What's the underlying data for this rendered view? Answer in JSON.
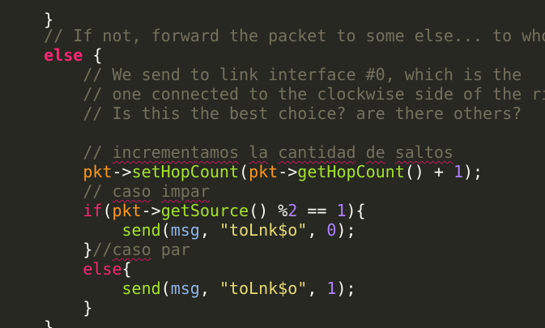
{
  "editor": {
    "theme": {
      "background": "#272822",
      "comment": "#75715e",
      "keyword": "#f92672",
      "function": "#a6e22e",
      "variable": "#fd971f",
      "number": "#ae81ff",
      "string": "#e6db74",
      "plain": "#f8f8f2",
      "spellcheck_underline": "#c2185b"
    },
    "lines": {
      "l0": {
        "t0": "}"
      },
      "l1": {
        "t0": "// If not, forward the packet to some else... to who?"
      },
      "l2": {
        "t0": "else",
        "t1": " {"
      },
      "l3": {
        "t0": "    // We send to link interface #0, which is the"
      },
      "l4": {
        "t0": "    // one connected to the clockwise side of the ring"
      },
      "l5": {
        "t0": "    // Is this the best choice? are there others?"
      },
      "l6": {
        "t0": ""
      },
      "l7": {
        "t0": "    ",
        "t1": "// ",
        "t2": "incrementamos",
        "t3": " ",
        "t4": "la",
        "t5": " ",
        "t6": "cantidad",
        "t7": " ",
        "t8": "de",
        "t9": " ",
        "t10": "saltos"
      },
      "l8": {
        "t0": "    ",
        "t1": "pkt",
        "t2": "->",
        "t3": "setHopCount",
        "t4": "(",
        "t5": "pkt",
        "t6": "->",
        "t7": "getHopCount",
        "t8": "() + ",
        "t9": "1",
        "t10": ");"
      },
      "l9": {
        "t0": "    ",
        "t1": "// ",
        "t2": "caso",
        "t3": " ",
        "t4": "impar"
      },
      "l10": {
        "t0": "    ",
        "t1": "if",
        "t2": "(",
        "t3": "pkt",
        "t4": "->",
        "t5": "getSource",
        "t6": "() ",
        "t7": "%",
        "t8": "2",
        "t9": " == ",
        "t10": "1",
        "t11": "){"
      },
      "l11": {
        "t0": "        ",
        "t1": "send",
        "t2": "(",
        "t3": "msg",
        "t4": ", ",
        "t5": "\"toLnk$o\"",
        "t6": ", ",
        "t7": "0",
        "t8": ");"
      },
      "l12": {
        "t0": "    ",
        "t1": "}",
        "t2": "//",
        "t3": "caso",
        "t4": " par"
      },
      "l13": {
        "t0": "    ",
        "t1": "else",
        "t2": "{"
      },
      "l14": {
        "t0": "        ",
        "t1": "send",
        "t2": "(",
        "t3": "msg",
        "t4": ", ",
        "t5": "\"toLnk$o\"",
        "t6": ", ",
        "t7": "1",
        "t8": ");"
      },
      "l15": {
        "t0": "    ",
        "t1": "}"
      },
      "l16": {
        "t0": "}"
      }
    }
  }
}
